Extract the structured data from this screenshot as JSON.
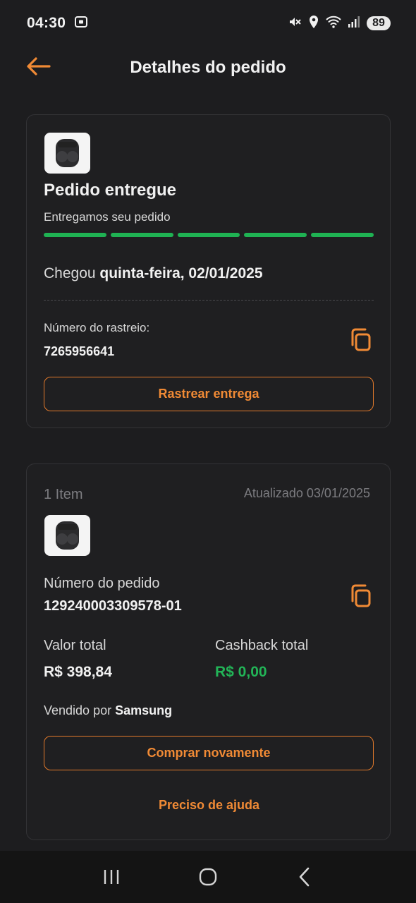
{
  "status_bar": {
    "time": "04:30",
    "battery": "89",
    "icons": [
      "screenshot-icon",
      "mute-icon",
      "location-icon",
      "wifi-icon",
      "signal-icon",
      "battery-icon"
    ]
  },
  "header": {
    "title": "Detalhes do pedido",
    "back_icon": "arrow-left-icon"
  },
  "delivery_card": {
    "status_title": "Pedido entregue",
    "status_subtitle": "Entregamos seu pedido",
    "progress": {
      "completed_steps": 5,
      "total_steps": 5
    },
    "arrival_prefix": "Chegou",
    "arrival_date": "quinta-feira, 02/01/2025",
    "tracking_label": "Número do rastreio:",
    "tracking_number": "7265956641",
    "track_button": "Rastrear entrega"
  },
  "order_card": {
    "item_count": "1 Item",
    "updated": "Atualizado 03/01/2025",
    "order_number_label": "Número do pedido",
    "order_number": "129240003309578-01",
    "total_label": "Valor total",
    "total_value": "R$ 398,84",
    "cashback_label": "Cashback total",
    "cashback_value": "R$ 0,00",
    "sold_by_prefix": "Vendido por",
    "seller": "Samsung",
    "buy_again_button": "Comprar novamente",
    "help_link": "Preciso de ajuda"
  },
  "colors": {
    "background": "#1d1d1f",
    "accent": "#f08a35",
    "success": "#1fb253",
    "muted": "#7c7c80"
  }
}
